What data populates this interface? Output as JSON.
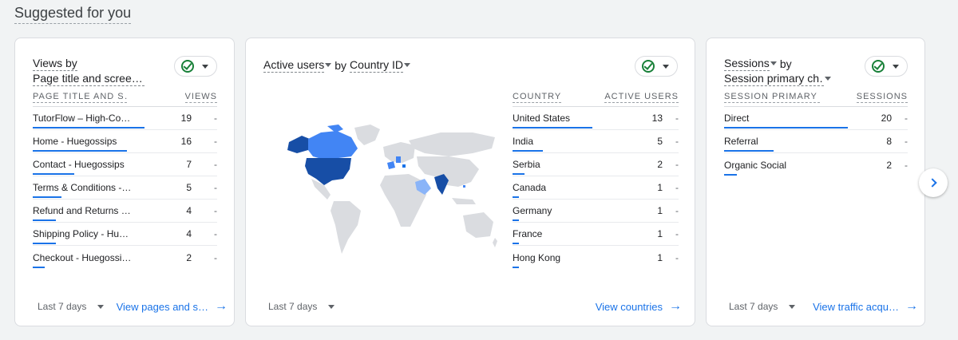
{
  "section_title": "Suggested for you",
  "cards": [
    {
      "title_line1": "Views by",
      "title_line2": "Page title and scree…",
      "col1": "PAGE TITLE AND S…",
      "col2": "VIEWS",
      "rows": [
        {
          "name": "TutorFlow – High-Co…",
          "value": "19",
          "change": "-",
          "fraction": 1.0
        },
        {
          "name": "Home - Huegossips",
          "value": "16",
          "change": "-",
          "fraction": 0.84
        },
        {
          "name": "Contact - Huegossips",
          "value": "7",
          "change": "-",
          "fraction": 0.37
        },
        {
          "name": "Terms & Conditions -…",
          "value": "5",
          "change": "-",
          "fraction": 0.26
        },
        {
          "name": "Refund and Returns …",
          "value": "4",
          "change": "-",
          "fraction": 0.21
        },
        {
          "name": "Shipping Policy - Hu…",
          "value": "4",
          "change": "-",
          "fraction": 0.21
        },
        {
          "name": "Checkout - Huegossi…",
          "value": "2",
          "change": "-",
          "fraction": 0.11
        }
      ],
      "range": "Last 7 days",
      "link": "View pages and s…"
    },
    {
      "title_metric": "Active users",
      "title_by": "by",
      "title_dim": "Country ID",
      "col1": "COUNTRY",
      "col2": "ACTIVE USERS",
      "rows": [
        {
          "name": "United States",
          "value": "13",
          "change": "-",
          "fraction": 1.0
        },
        {
          "name": "India",
          "value": "5",
          "change": "-",
          "fraction": 0.38
        },
        {
          "name": "Serbia",
          "value": "2",
          "change": "-",
          "fraction": 0.15
        },
        {
          "name": "Canada",
          "value": "1",
          "change": "-",
          "fraction": 0.08
        },
        {
          "name": "Germany",
          "value": "1",
          "change": "-",
          "fraction": 0.08
        },
        {
          "name": "France",
          "value": "1",
          "change": "-",
          "fraction": 0.08
        },
        {
          "name": "Hong Kong",
          "value": "1",
          "change": "-",
          "fraction": 0.08
        }
      ],
      "range": "Last 7 days",
      "link": "View countries"
    },
    {
      "title_metric": "Sessions",
      "title_by": "by",
      "title_line2": "Session primary ch…",
      "col1": "SESSION PRIMARY …",
      "col2": "SESSIONS",
      "rows": [
        {
          "name": "Direct",
          "value": "20",
          "change": "-",
          "fraction": 1.0
        },
        {
          "name": "Referral",
          "value": "8",
          "change": "-",
          "fraction": 0.4
        },
        {
          "name": "Organic Social",
          "value": "2",
          "change": "-",
          "fraction": 0.1
        }
      ],
      "range": "Last 7 days",
      "link": "View traffic acqu…"
    }
  ],
  "colors": {
    "accent": "#1a73e8",
    "map_dark": "#174ea6",
    "map_mid": "#4285f4",
    "map_light": "#8ab4f8",
    "map_base": "#dadce0",
    "check": "#188038"
  },
  "icons": {
    "check": "check-circle-icon",
    "arrow": "arrow-right-icon",
    "next": "chevron-right-icon"
  }
}
